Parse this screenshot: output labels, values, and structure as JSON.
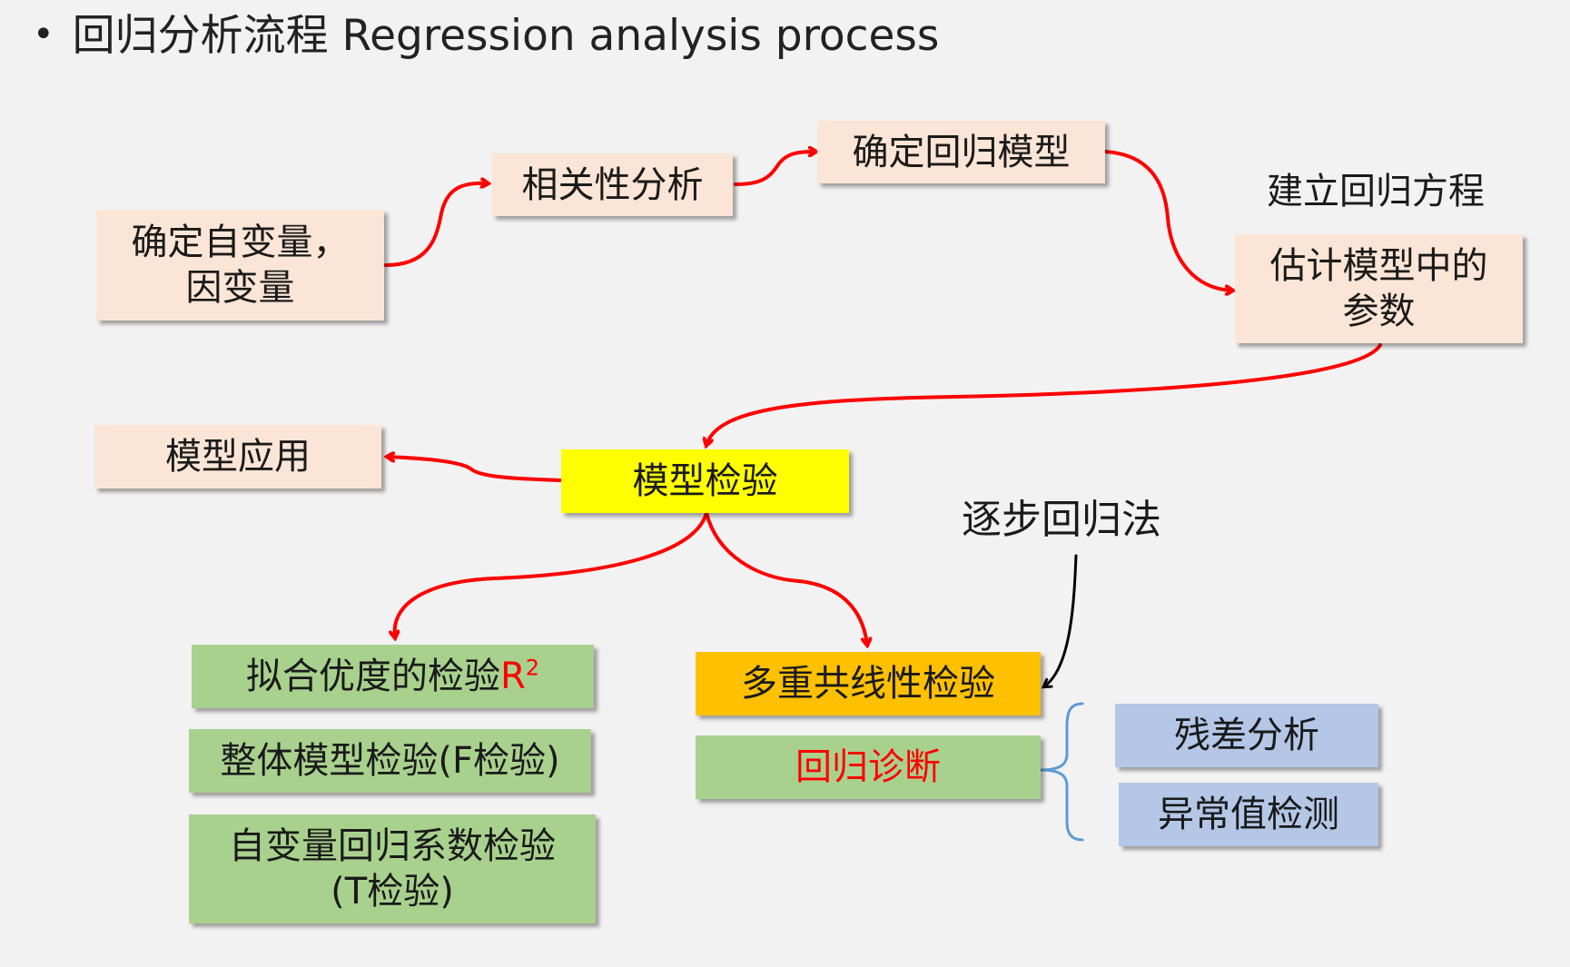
{
  "title": "回归分析流程 Regression analysis process",
  "nodes": {
    "define_vars": "确定自变量，\n因变量",
    "correlation": "相关性分析",
    "determine_model": "确定回归模型",
    "build_equation": "建立回归方程",
    "estimate_params": "估计模型中的\n参数",
    "model_application": "模型应用",
    "model_test": "模型检验",
    "stepwise": "逐步回归法",
    "goodness_of_fit": "拟合优度的检验",
    "goodness_of_fit_symbol": "R",
    "goodness_of_fit_sup": "2",
    "overall_test": "整体模型检验(F检验)",
    "coef_test": "自变量回归系数检验\n(T检验)",
    "multicollinearity": "多重共线性检验",
    "regression_diagnosis": "回归诊断",
    "residual_analysis": "残差分析",
    "outlier_detection": "异常值检测"
  },
  "colors": {
    "background": "#f2f2f2",
    "peach": "#fbe5d6",
    "yellow": "#ffff00",
    "orange": "#ffc000",
    "green": "#a9d18e",
    "blue": "#b4c7e7",
    "arrow_red": "#ff0000",
    "arrow_black": "#000000",
    "brace_blue": "#5b9bd5"
  }
}
